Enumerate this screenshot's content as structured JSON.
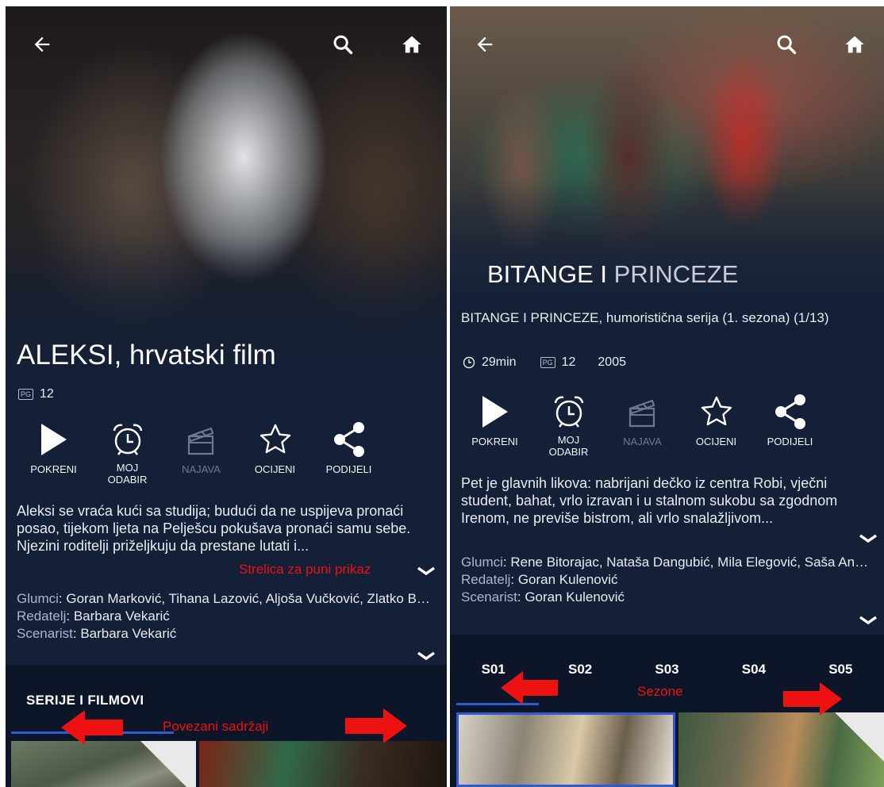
{
  "left": {
    "title": "ALEKSI, hrvatski film",
    "rating": "12",
    "rating_badge": "PG",
    "actions": [
      {
        "label": "POKRENI"
      },
      {
        "label": "MOJ\nODABIR"
      },
      {
        "label": "NAJAVA"
      },
      {
        "label": "OCIJENI"
      },
      {
        "label": "PODIJELI"
      }
    ],
    "description": "Aleksi se vraća kući sa studija; budući da ne uspijeva pronaći posao, tijekom ljeta na Pelješcu pokušava pronaći samu sebe. Njezini roditelji priželjkuju da prestane lutati i...",
    "annotation_expand": "Strelica za puni prikaz",
    "credits": {
      "cast_key": "Glumci",
      "cast_value": ": Goran Marković, Tihana Lazović, Aljoša Vučković, Zlatko Burić",
      "director_key": "Redatelj",
      "director_value": ": Barbara Vekarić",
      "writer_key": "Scenarist",
      "writer_value": ": Barbara Vekarić"
    },
    "section_title": "SERIJE I FILMOVI",
    "annotation_related": "Povezani sadržaji"
  },
  "right": {
    "title_bold": "BITANGE I",
    "title_light": "PRINCEZE",
    "subtitle": "BITANGE I PRINCEZE, humoristična serija (1. sezona) (1/13)",
    "duration": "29min",
    "rating": "12",
    "rating_badge": "PG",
    "year": "2005",
    "actions": [
      {
        "label": "POKRENI"
      },
      {
        "label": "MOJ\nODABIR"
      },
      {
        "label": "NAJAVA"
      },
      {
        "label": "OCIJENI"
      },
      {
        "label": "PODIJELI"
      }
    ],
    "description": "Pet je glavnih likova: nabrijani dečko iz centra Robi, vječni student, bahat, vrlo izravan i u stalnom sukobu sa zgodnom Irenom, ne previše bistrom, ali vrlo snalažljivom...",
    "credits": {
      "cast_key": "Glumci",
      "cast_value": ": Rene Bitorajac, Nataša Dangubić, Mila Elegović, Saša Anočić",
      "director_key": "Redatelj",
      "director_value": ": Goran Kulenović",
      "writer_key": "Scenarist",
      "writer_value": ": Goran Kulenović"
    },
    "seasons": [
      "S01",
      "S02",
      "S03",
      "S04",
      "S05"
    ],
    "annotation_seasons": "Sezone"
  }
}
